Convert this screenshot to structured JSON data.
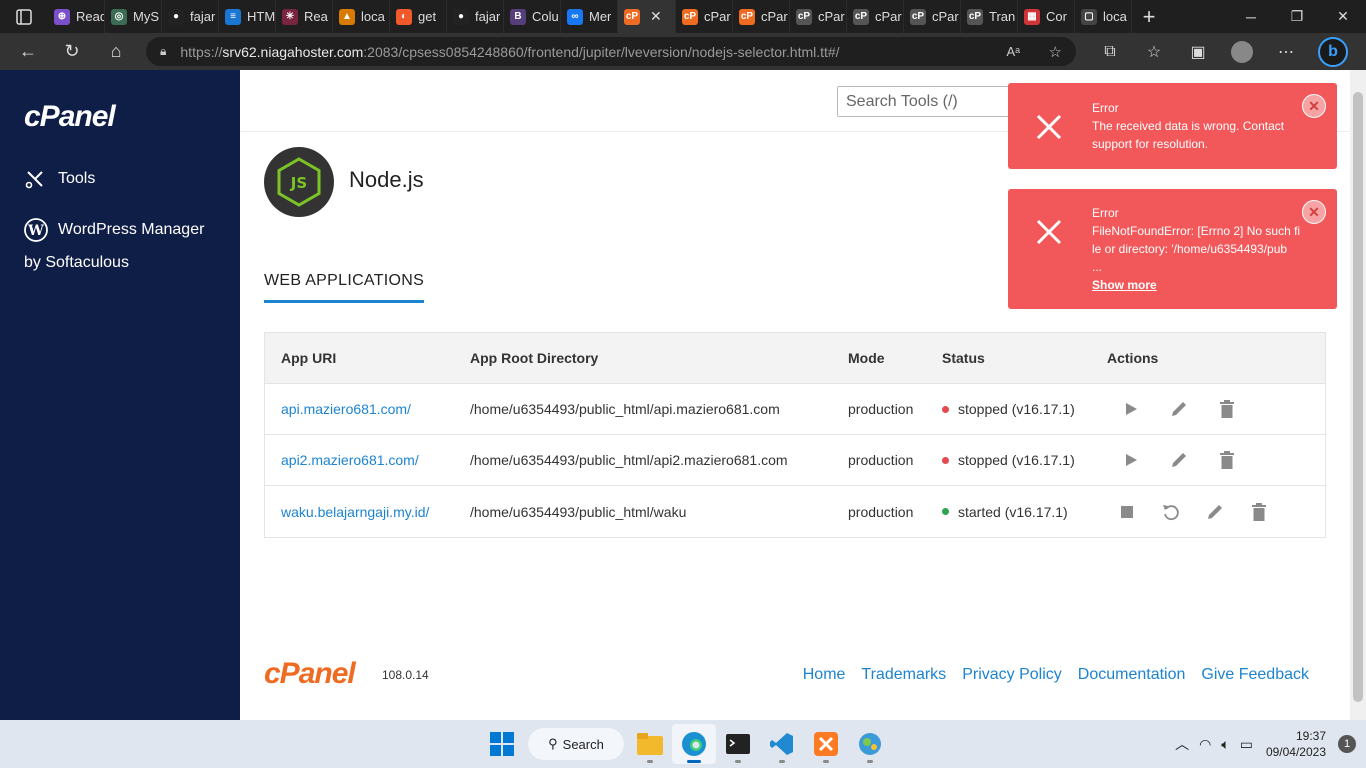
{
  "browser": {
    "tabs": [
      {
        "title": "Read",
        "color": "#7b4fc9",
        "glyph": "⊕"
      },
      {
        "title": "MyS",
        "color": "#3b6d55",
        "glyph": "◎"
      },
      {
        "title": "fajar",
        "color": "#222222",
        "glyph": "●"
      },
      {
        "title": "HTM",
        "color": "#1976d2",
        "glyph": "≡"
      },
      {
        "title": "Rea",
        "color": "#7a2540",
        "glyph": "✳"
      },
      {
        "title": "loca",
        "color": "#d97a00",
        "glyph": "▲"
      },
      {
        "title": "get",
        "color": "#f1592a",
        "glyph": "◐"
      },
      {
        "title": "fajar",
        "color": "#222222",
        "glyph": "●"
      },
      {
        "title": "Colu",
        "color": "#563d7c",
        "glyph": "B"
      },
      {
        "title": "Mer",
        "color": "#1877f2",
        "glyph": "∞"
      },
      {
        "title": "",
        "color": "#f06b22",
        "glyph": "cP",
        "active": true
      },
      {
        "title": "cPar",
        "color": "#f06b22",
        "glyph": "cP"
      },
      {
        "title": "cPar",
        "color": "#f06b22",
        "glyph": "cP"
      },
      {
        "title": "cPar",
        "color": "#555555",
        "glyph": "cP"
      },
      {
        "title": "cPar",
        "color": "#555555",
        "glyph": "cP"
      },
      {
        "title": "cPar",
        "color": "#555555",
        "glyph": "cP"
      },
      {
        "title": "Tran",
        "color": "#555555",
        "glyph": "cP"
      },
      {
        "title": "Cor",
        "color": "#d13438",
        "glyph": "▦"
      },
      {
        "title": "loca",
        "color": "#444444",
        "glyph": "▢"
      }
    ],
    "url_prefix": "https://",
    "url_host": "srv62.niagahoster.com",
    "url_rest": ":2083/cpsess0854248860/frontend/jupiter/lveversion/nodejs-selector.html.tt#/"
  },
  "sidebar": {
    "brand": "cPanel",
    "tools_label": "Tools",
    "wp_label_line1": "WordPress Manager",
    "wp_label_line2": "by Softaculous"
  },
  "header": {
    "search_placeholder": "Search Tools (/)"
  },
  "page": {
    "title": "Node.js",
    "section_title": "WEB APPLICATIONS"
  },
  "table": {
    "headers": {
      "uri": "App URI",
      "root": "App Root Directory",
      "mode": "Mode",
      "status": "Status",
      "actions": "Actions"
    },
    "rows": [
      {
        "uri": "api.maziero681.com/",
        "root": "/home/u6354493/public_html/api.maziero681.com",
        "mode": "production",
        "status": "stopped (v16.17.1)",
        "state": "stopped"
      },
      {
        "uri": "api2.maziero681.com/",
        "root": "/home/u6354493/public_html/api2.maziero681.com",
        "mode": "production",
        "status": "stopped (v16.17.1)",
        "state": "stopped"
      },
      {
        "uri": "waku.belajarngaji.my.id/",
        "root": "/home/u6354493/public_html/waku",
        "mode": "production",
        "status": "started (v16.17.1)",
        "state": "started"
      }
    ]
  },
  "footer": {
    "brand": "cPanel",
    "version": "108.0.14",
    "links": [
      "Home",
      "Trademarks",
      "Privacy Policy",
      "Documentation",
      "Give Feedback"
    ]
  },
  "toasts": [
    {
      "heading": "Error",
      "message": "The received data is wrong. Contact support for resolution."
    },
    {
      "heading": "Error",
      "message": "FileNotFoundError: [Errno 2] No such file or directory: '/home/u6354493/pub",
      "ellipsis": "...",
      "more": "Show more"
    }
  ],
  "taskbar": {
    "search_label": "Search",
    "time": "19:37",
    "date": "09/04/2023",
    "notifications": "1"
  },
  "colors": {
    "sidebar_bg": "#0f1e46",
    "accent_link": "#1d84d0",
    "toast_bg": "#f2585a",
    "status_stopped": "#e5484d",
    "status_started": "#2ea44f",
    "cpanel_orange": "#f06b22"
  }
}
